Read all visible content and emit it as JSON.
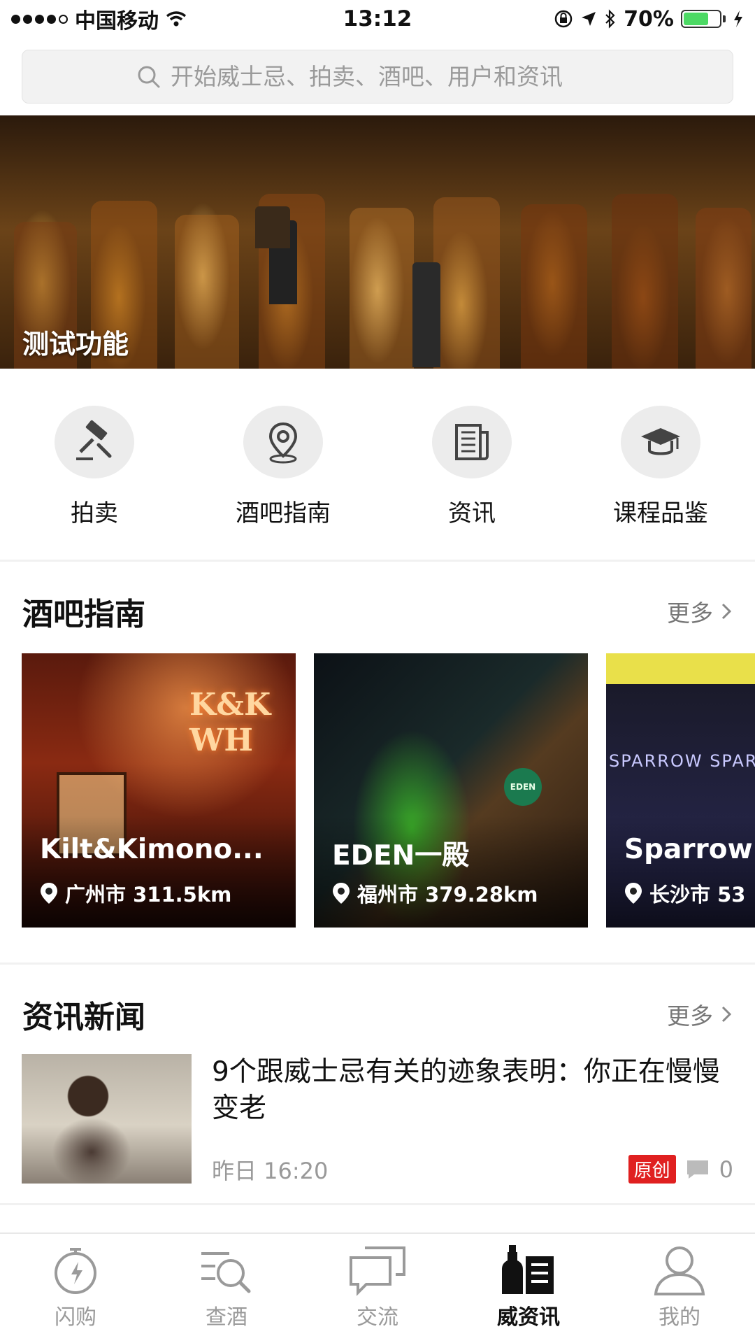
{
  "status_bar": {
    "carrier": "中国移动",
    "time": "13:12",
    "battery": "70%",
    "battery_level": 0.7
  },
  "search": {
    "placeholder": "开始威士忌、拍卖、酒吧、用户和资讯"
  },
  "banner": {
    "caption": "测试功能"
  },
  "quick_entries": [
    {
      "label": "拍卖",
      "icon": "gavel-icon"
    },
    {
      "label": "酒吧指南",
      "icon": "map-pin-icon"
    },
    {
      "label": "资讯",
      "icon": "newspaper-icon"
    },
    {
      "label": "课程品鉴",
      "icon": "graduation-cap-icon"
    }
  ],
  "bar_guide": {
    "title": "酒吧指南",
    "more": "更多",
    "cards": [
      {
        "name": "Kilt&Kimono...",
        "location": "广州市 311.5km",
        "sign_text": "K&K WH"
      },
      {
        "name": "EDEN一殿",
        "location": "福州市 379.28km",
        "logo_text": "EDEN"
      },
      {
        "name": "Sparrow",
        "location": "长沙市 53",
        "sign_text": "SPARROW SPARRO"
      }
    ]
  },
  "news": {
    "title": "资讯新闻",
    "more": "更多",
    "items": [
      {
        "title": "9个跟威士忌有关的迹象表明：你正在慢慢变老",
        "time": "昨日 16:20",
        "badge": "原创",
        "comments": "0"
      }
    ]
  },
  "tabbar": {
    "tabs": [
      {
        "label": "闪购",
        "icon": "stopwatch-icon",
        "active": false
      },
      {
        "label": "查酒",
        "icon": "search-list-icon",
        "active": false
      },
      {
        "label": "交流",
        "icon": "chat-bubbles-icon",
        "active": false
      },
      {
        "label": "威资讯",
        "icon": "bottle-news-icon",
        "active": true
      },
      {
        "label": "我的",
        "icon": "user-icon",
        "active": false
      }
    ]
  },
  "colors": {
    "accent_badge": "#e02020",
    "battery_green": "#4cd964",
    "inactive_tab": "#9a9a9a"
  }
}
